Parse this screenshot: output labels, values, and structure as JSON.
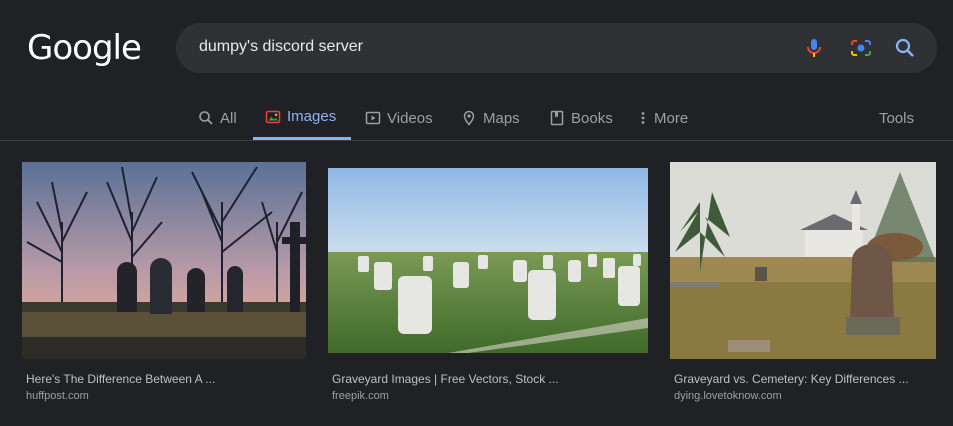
{
  "logo": {
    "text": "Google"
  },
  "search": {
    "query": "dumpy's discord server"
  },
  "tabs": [
    {
      "label": "All",
      "icon": "search-icon"
    },
    {
      "label": "Images",
      "icon": "images-icon",
      "active": true
    },
    {
      "label": "Videos",
      "icon": "video-icon"
    },
    {
      "label": "Maps",
      "icon": "map-pin-icon"
    },
    {
      "label": "Books",
      "icon": "book-icon"
    },
    {
      "label": "More",
      "icon": "more-vertical-icon"
    }
  ],
  "tools_label": "Tools",
  "results": [
    {
      "title": "Here's The Difference Between A ...",
      "source": "huffpost.com"
    },
    {
      "title": "Graveyard Images | Free Vectors, Stock ...",
      "source": "freepik.com"
    },
    {
      "title": "Graveyard vs. Cemetery: Key Differences ...",
      "source": "dying.lovetoknow.com"
    }
  ],
  "colors": {
    "background": "#202124",
    "search_bg": "#303134",
    "accent": "#8ab4f8"
  }
}
